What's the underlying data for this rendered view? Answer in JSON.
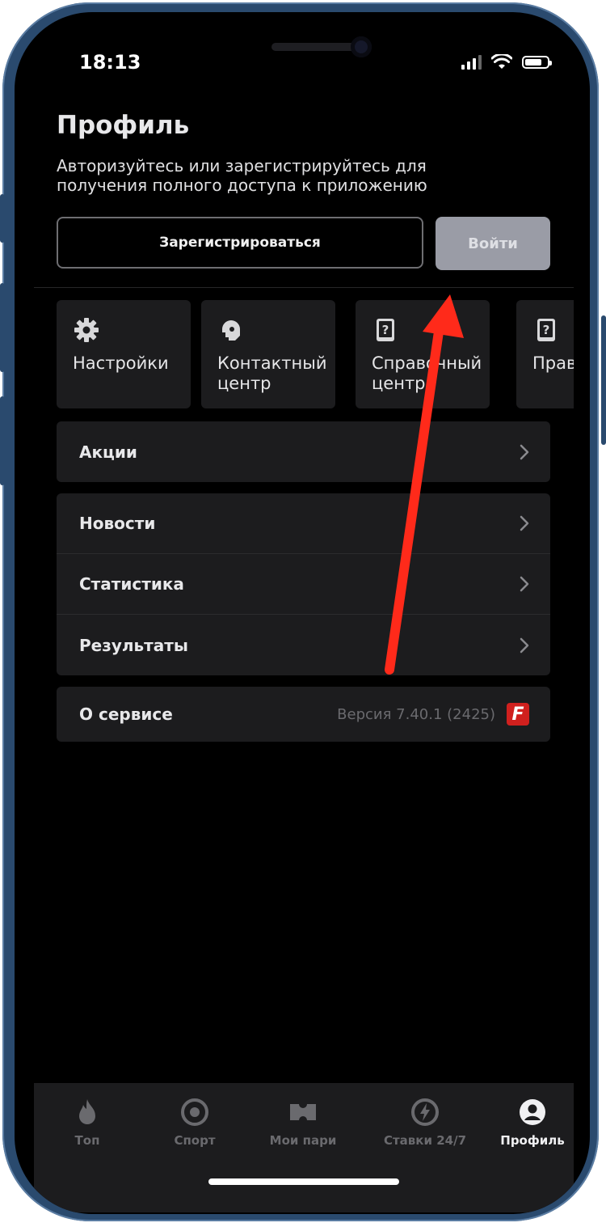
{
  "status_bar": {
    "time": "18:13"
  },
  "profile": {
    "title": "Профиль",
    "subtitle": "Авторизуйтесь или зарегистрируйтесь для получения полного доступа к приложению",
    "register_label": "Зарегистрироваться",
    "login_label": "Войти"
  },
  "tiles": [
    {
      "label": "Настройки",
      "icon": "gear-icon"
    },
    {
      "label": "Контактный\nцентр",
      "icon": "headset-icon"
    },
    {
      "label": "Справочный\nцентр",
      "icon": "help-book-icon"
    },
    {
      "label": "Прав",
      "icon": "rules-book-icon"
    }
  ],
  "menu": {
    "promotions": "Акции",
    "news": "Новости",
    "statistics": "Статистика",
    "results": "Результаты",
    "about": "О сервисе",
    "version": "Версия 7.40.1 (2425)",
    "logo_letter": "F"
  },
  "tabbar": {
    "tabs": [
      {
        "label": "Топ",
        "icon": "flame-icon"
      },
      {
        "label": "Спорт",
        "icon": "target-icon"
      },
      {
        "label": "Мои пари",
        "icon": "ticket-icon"
      },
      {
        "label": "Ставки 24/7",
        "icon": "lightning-icon"
      },
      {
        "label": "Профиль",
        "icon": "user-icon"
      }
    ],
    "active": "Профиль"
  },
  "colors": {
    "background": "#000000",
    "card": "#1c1c1e",
    "login_button": "#9a9ca6",
    "annotation_arrow": "#ff2a1a",
    "brand_logo": "#d0201e"
  }
}
